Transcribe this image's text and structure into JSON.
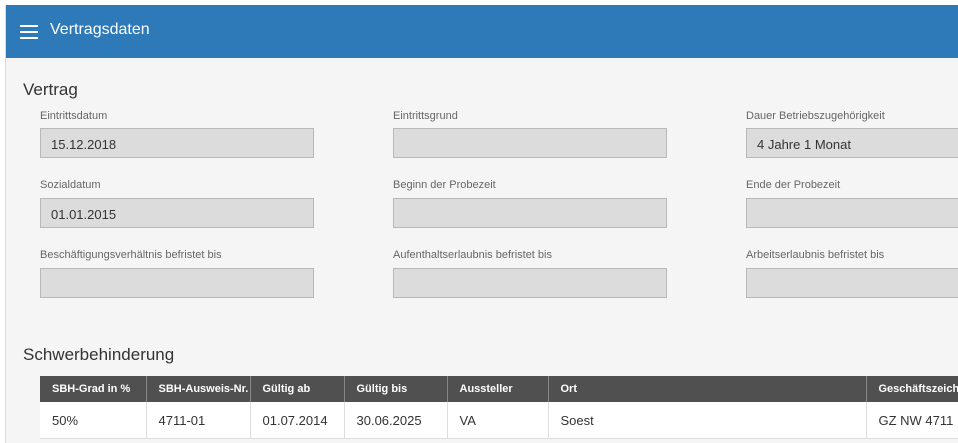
{
  "header": {
    "title": "Vertragsdaten"
  },
  "vertrag": {
    "title": "Vertrag",
    "fields": {
      "eintrittsdatum": {
        "label": "Eintrittsdatum",
        "value": "15.12.2018"
      },
      "eintrittsgrund": {
        "label": "Eintrittsgrund",
        "value": ""
      },
      "dauer": {
        "label": "Dauer Betriebszugehörigkeit",
        "value": "4 Jahre 1 Monat"
      },
      "sozialdatum": {
        "label": "Sozialdatum",
        "value": "01.01.2015"
      },
      "probezeit_beginn": {
        "label": "Beginn der Probezeit",
        "value": ""
      },
      "probezeit_ende": {
        "label": "Ende der Probezeit",
        "value": ""
      },
      "beschaeftigung": {
        "label": "Beschäftigungsverhältnis befristet bis",
        "value": ""
      },
      "aufenthalt": {
        "label": "Aufenthaltserlaubnis befristet bis",
        "value": ""
      },
      "arbeit": {
        "label": "Arbeitserlaubnis befristet bis",
        "value": ""
      }
    }
  },
  "sbh": {
    "title": "Schwerbehinderung",
    "columns": [
      "SBH-Grad in %",
      "SBH-Ausweis-Nr.",
      "Gültig ab",
      "Gültig bis",
      "Aussteller",
      "Ort",
      "Geschäftszeichen"
    ],
    "rows": [
      [
        "50%",
        "4711-01",
        "01.07.2014",
        "30.06.2025",
        "VA",
        "Soest",
        "GZ NW 4711"
      ]
    ]
  }
}
